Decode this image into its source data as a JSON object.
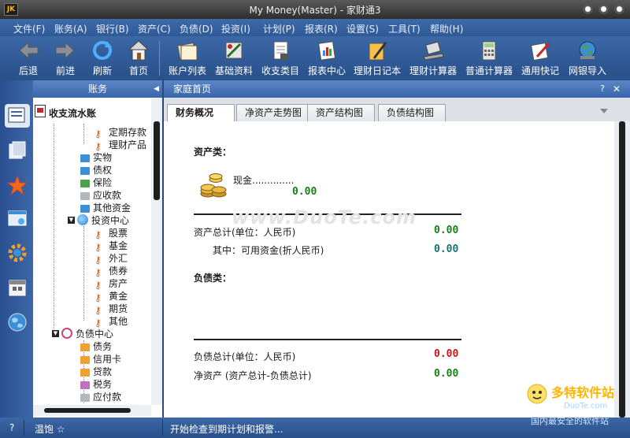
{
  "window": {
    "title": "My Money(Master) - 家财通3",
    "logo_text": "JK"
  },
  "menu": [
    "文件(F)",
    "账务(A)",
    "银行(B)",
    "资产(C)",
    "负债(D)",
    "投资(I)",
    "计划(P)",
    "报表(R)",
    "设置(S)",
    "工具(T)",
    "帮助(H)"
  ],
  "toolbar": {
    "back": "后退",
    "forward": "前进",
    "refresh": "刷新",
    "home": "首页",
    "accounts": "账户列表",
    "basic": "基础资料",
    "categories": "收支类目",
    "reports": "报表中心",
    "diary": "理财日记本",
    "fin_calc": "理财计算器",
    "calc": "普通计算器",
    "notes": "通用快记",
    "import": "网银导入"
  },
  "tree": {
    "header": "账务",
    "root": "收支流水账",
    "items": [
      "定期存款",
      "理财产品",
      "实物",
      "债权",
      "保险",
      "应收款",
      "其他资金",
      "投资中心",
      "股票",
      "基金",
      "外汇",
      "债券",
      "房产",
      "黄金",
      "期货",
      "其他",
      "负债中心",
      "债务",
      "信用卡",
      "贷款",
      "税务",
      "应付款"
    ]
  },
  "content": {
    "header": "家庭首页",
    "help": "?",
    "close": "✕",
    "tabs": [
      "财务概况",
      "净资产走势图",
      "资产结构图",
      "负债结构图"
    ],
    "asset_title": "资产类：",
    "cash_label": "现金..............",
    "cash_value": "0.00",
    "asset_total_label": "资产总计(单位：人民币)",
    "asset_total_value": "0.00",
    "available_label": "其中：可用资金(折人民币)",
    "available_value": "0.00",
    "liability_title": "负债类：",
    "liability_total_label": "负债总计(单位：人民币)",
    "liability_total_value": "0.00",
    "net_label": "净资产 (资产总计-负债总计)",
    "net_value": "0.00",
    "watermark": "www.DuoTe.com"
  },
  "status": {
    "help": "?",
    "state": "温饱 ☆",
    "message": "开始检查到期计划和报警..."
  },
  "brand": {
    "name": "多特软件站",
    "url": "DuoTe.com",
    "tagline": "国内最安全的软件站"
  },
  "colors": {
    "positive": "#1a7d1a",
    "negative": "#c61a1a",
    "accent": "#3a66aa"
  }
}
